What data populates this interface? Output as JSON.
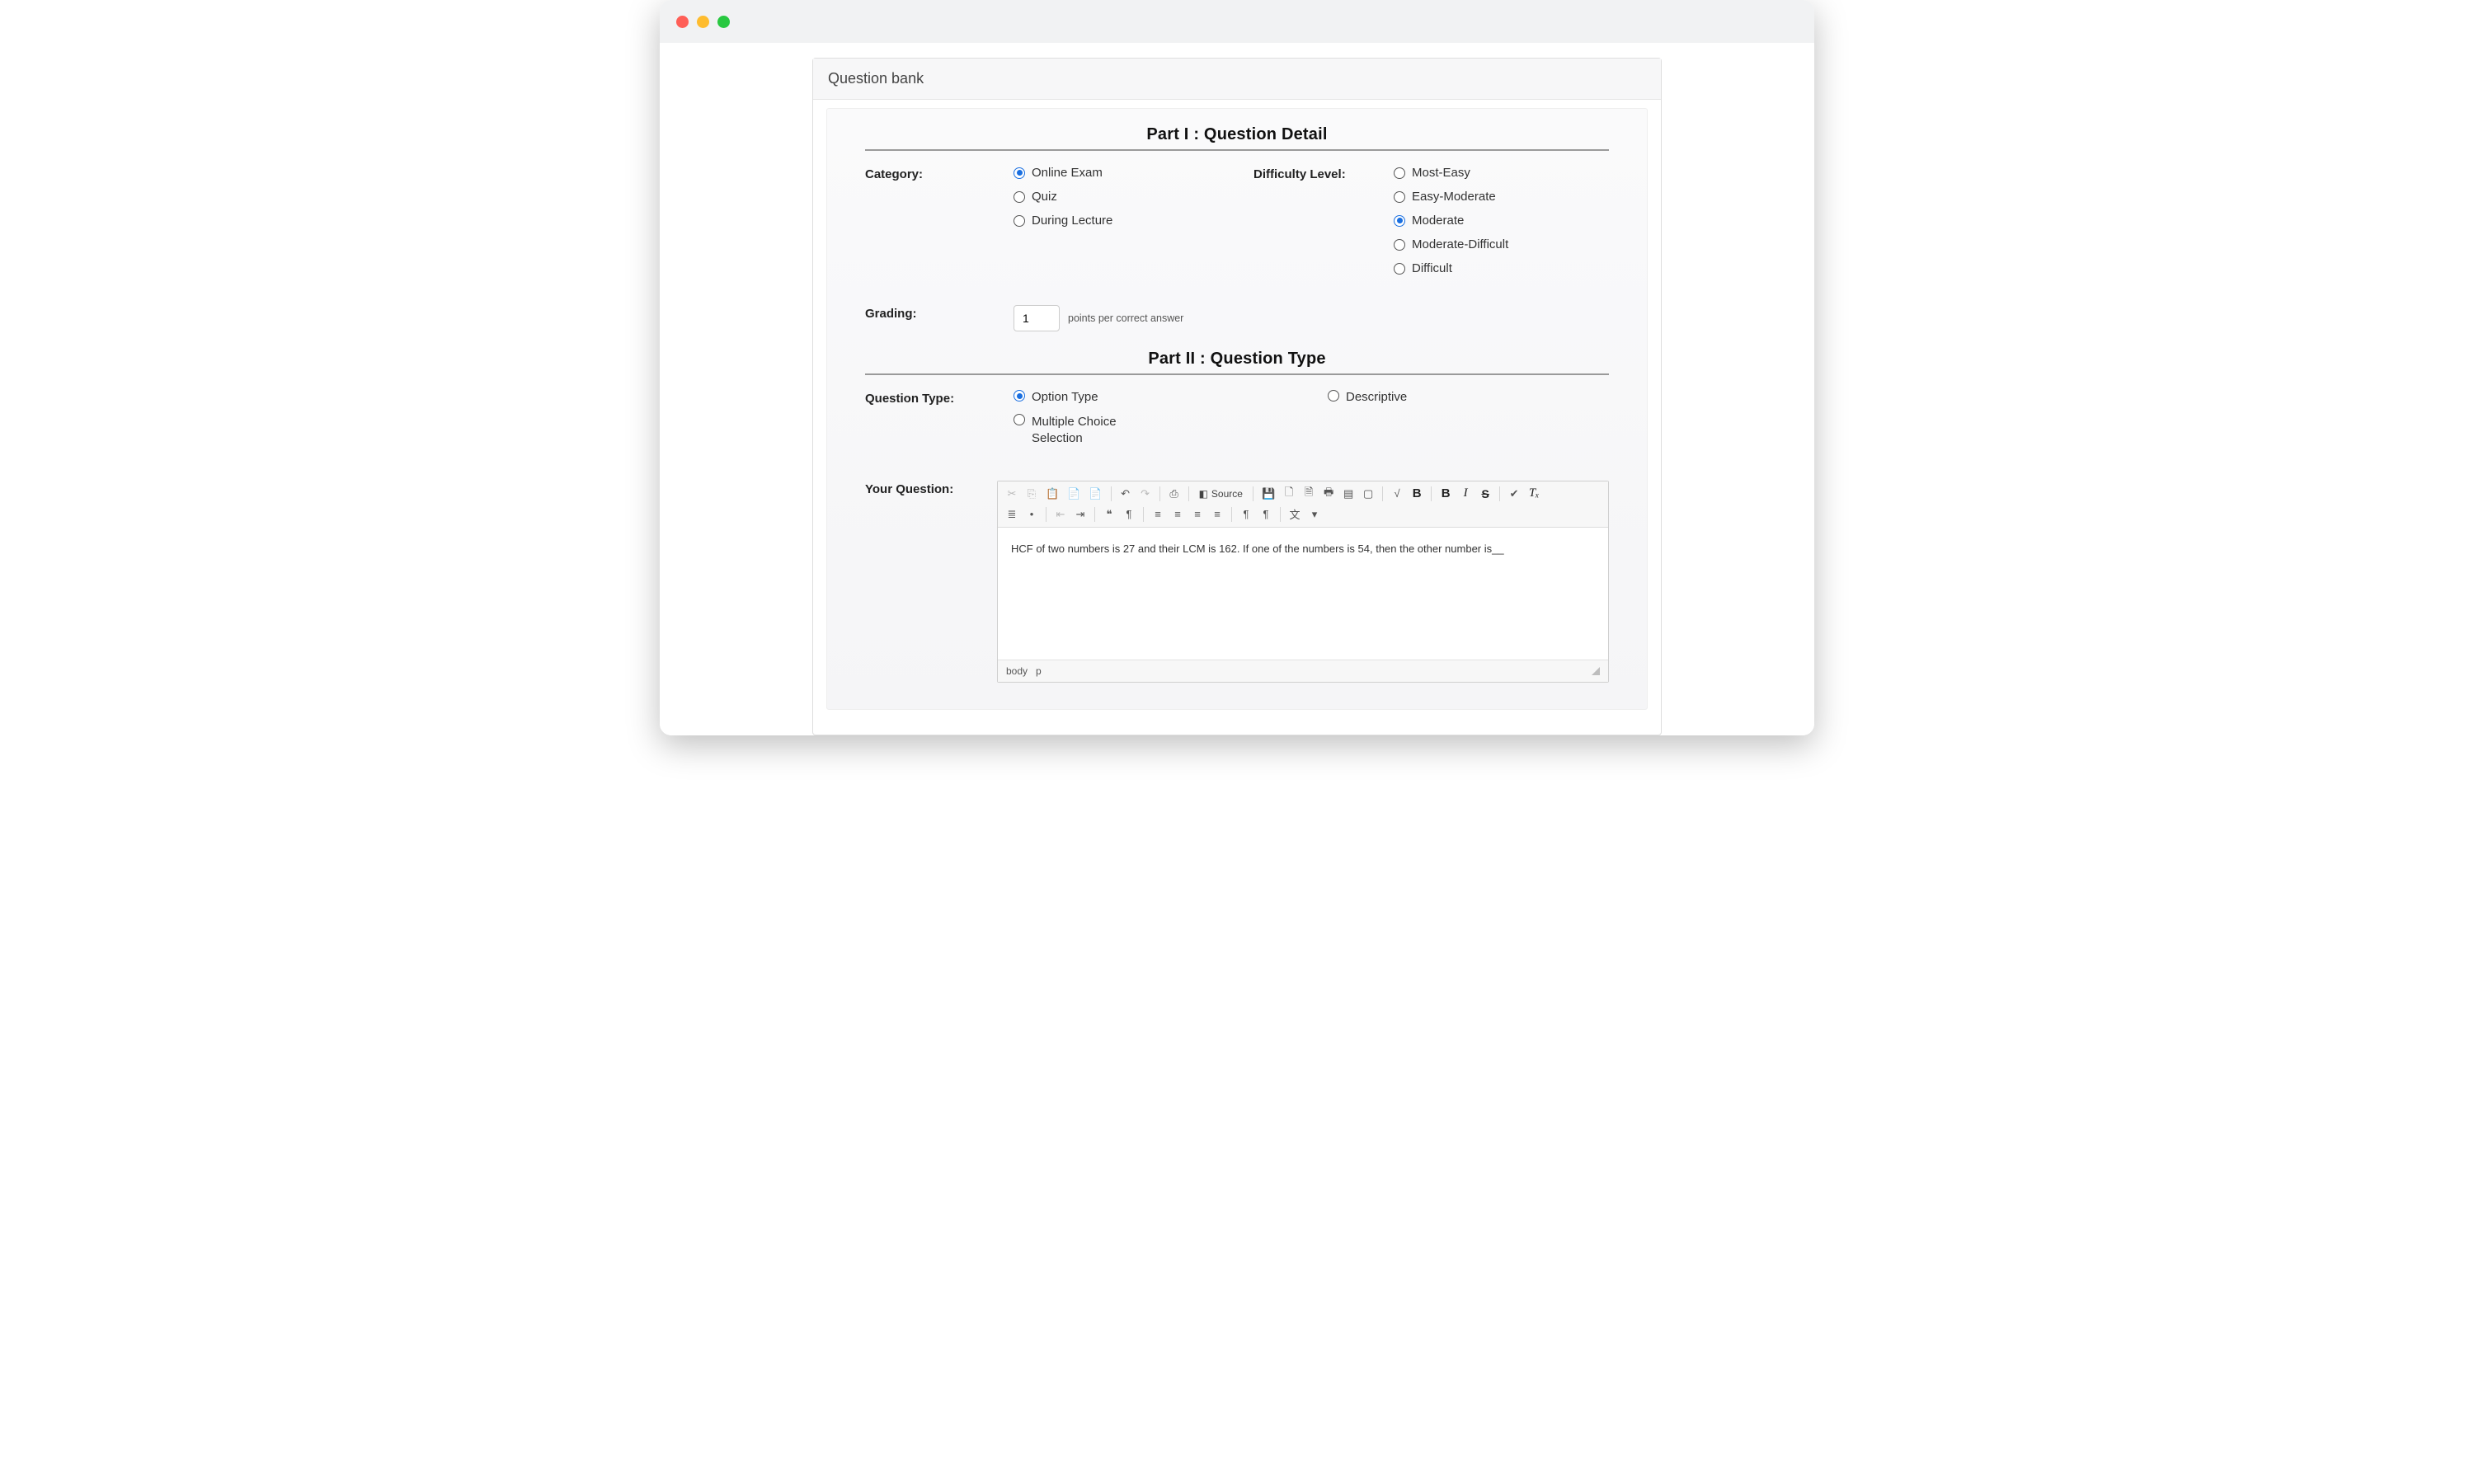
{
  "header": {
    "title": "Question bank"
  },
  "part1": {
    "title": "Part I : Question Detail",
    "categoryLabel": "Category:",
    "categoryOptions": [
      {
        "label": "Online Exam",
        "checked": true
      },
      {
        "label": "Quiz",
        "checked": false
      },
      {
        "label": "During Lecture",
        "checked": false
      }
    ],
    "difficultyLabel": "Difficulty Level:",
    "difficultyOptions": [
      {
        "label": "Most-Easy",
        "checked": false
      },
      {
        "label": "Easy-Moderate",
        "checked": false
      },
      {
        "label": "Moderate",
        "checked": true
      },
      {
        "label": "Moderate-Difficult",
        "checked": false
      },
      {
        "label": "Difficult",
        "checked": false
      }
    ],
    "gradingLabel": "Grading:",
    "gradingValue": "1",
    "gradingHint": "points per correct answer"
  },
  "part2": {
    "title": "Part II : Question Type",
    "qtypeLabel": "Question Type:",
    "qtypeLeft": [
      {
        "label": "Option Type",
        "checked": true
      },
      {
        "label": "Multiple Choice Selection",
        "checked": false
      }
    ],
    "qtypeRight": [
      {
        "label": "Descriptive",
        "checked": false
      }
    ],
    "yourQuestionLabel": "Your Question:"
  },
  "editor": {
    "sourceLabel": "Source",
    "content": "HCF of two numbers is 27 and their LCM is 162. If one of the numbers is 54, then the other number is__",
    "pathBody": "body",
    "pathP": "p",
    "glyphs": {
      "cut": "✂",
      "copy": "⎘",
      "paste": "📋",
      "pasteText": "📄",
      "pasteWord": "📄",
      "undo": "↶",
      "redo": "↷",
      "spell": "⎙",
      "find": "◧",
      "save": "💾",
      "newpage": "🗋",
      "preview": "🗎",
      "print": "🖶",
      "printArea": "▤",
      "maximize": "▢",
      "math": "√",
      "check": "✔",
      "tx": "Tₓ",
      "blocks": "▦",
      "ol": "≣",
      "ul": "•",
      "outdent": "⇤",
      "indent": "⇥",
      "quote": "❝",
      "div": "¶",
      "left": "≡",
      "center": "≡",
      "right": "≡",
      "justify": "≡",
      "ltr": "¶",
      "rtl": "¶",
      "lang": "文"
    }
  }
}
